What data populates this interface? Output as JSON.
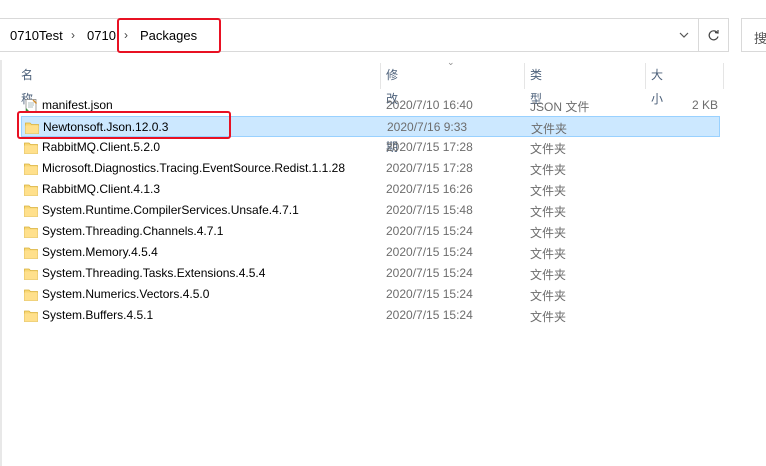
{
  "breadcrumb": {
    "items": [
      "0710Test",
      "0710",
      "Packages"
    ],
    "separator": "›"
  },
  "search": {
    "partial_label": "搜"
  },
  "columns": {
    "name": "名称",
    "date": "修改日期",
    "type": "类型",
    "size": "大小"
  },
  "files": [
    {
      "name": "manifest.json",
      "date": "2020/7/10 16:40",
      "type": "JSON 文件",
      "size": "2 KB",
      "icon": "json-file-icon",
      "selected": false
    },
    {
      "name": "Newtonsoft.Json.12.0.3",
      "date": "2020/7/16 9:33",
      "type": "文件夹",
      "size": "",
      "icon": "folder-icon",
      "selected": true
    },
    {
      "name": "RabbitMQ.Client.5.2.0",
      "date": "2020/7/15 17:28",
      "type": "文件夹",
      "size": "",
      "icon": "folder-icon",
      "selected": false
    },
    {
      "name": "Microsoft.Diagnostics.Tracing.EventSource.Redist.1.1.28",
      "date": "2020/7/15 17:28",
      "type": "文件夹",
      "size": "",
      "icon": "folder-icon",
      "selected": false
    },
    {
      "name": "RabbitMQ.Client.4.1.3",
      "date": "2020/7/15 16:26",
      "type": "文件夹",
      "size": "",
      "icon": "folder-icon",
      "selected": false
    },
    {
      "name": "System.Runtime.CompilerServices.Unsafe.4.7.1",
      "date": "2020/7/15 15:48",
      "type": "文件夹",
      "size": "",
      "icon": "folder-icon",
      "selected": false
    },
    {
      "name": "System.Threading.Channels.4.7.1",
      "date": "2020/7/15 15:24",
      "type": "文件夹",
      "size": "",
      "icon": "folder-icon",
      "selected": false
    },
    {
      "name": "System.Memory.4.5.4",
      "date": "2020/7/15 15:24",
      "type": "文件夹",
      "size": "",
      "icon": "folder-icon",
      "selected": false
    },
    {
      "name": "System.Threading.Tasks.Extensions.4.5.4",
      "date": "2020/7/15 15:24",
      "type": "文件夹",
      "size": "",
      "icon": "folder-icon",
      "selected": false
    },
    {
      "name": "System.Numerics.Vectors.4.5.0",
      "date": "2020/7/15 15:24",
      "type": "文件夹",
      "size": "",
      "icon": "folder-icon",
      "selected": false
    },
    {
      "name": "System.Buffers.4.5.1",
      "date": "2020/7/15 15:24",
      "type": "文件夹",
      "size": "",
      "icon": "folder-icon",
      "selected": false
    }
  ],
  "colors": {
    "selection_bg": "#cce8ff",
    "highlight_red": "#e81123",
    "folder_yellow": "#f8d775"
  }
}
